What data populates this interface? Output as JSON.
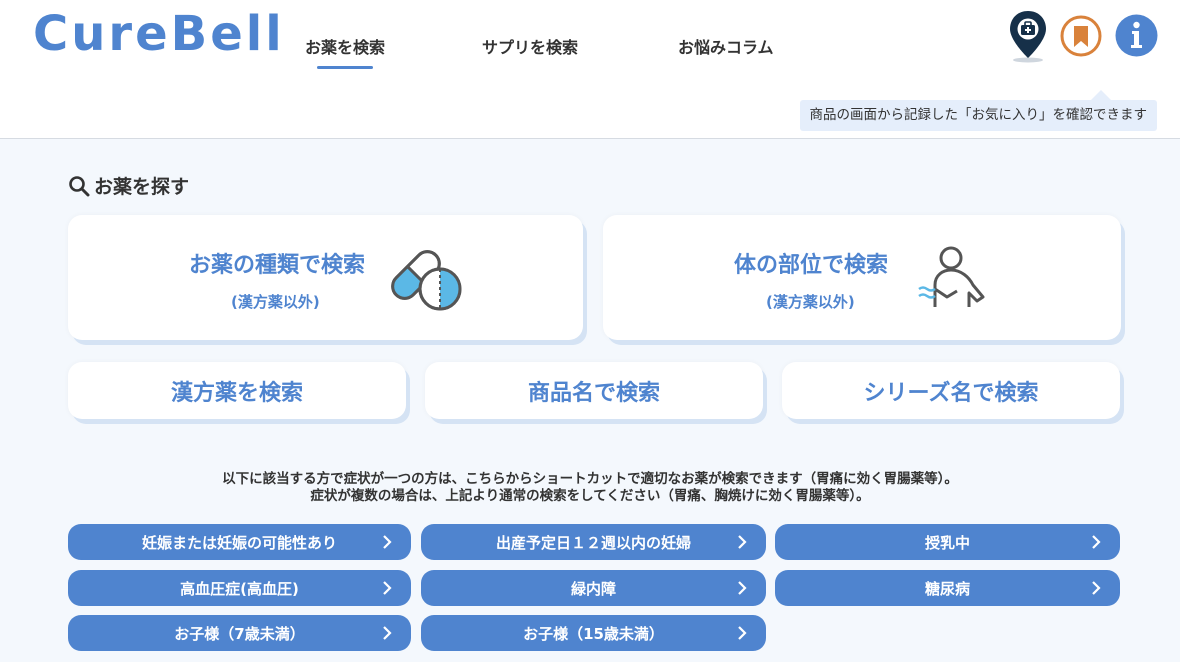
{
  "header": {
    "logo": "CureBell",
    "nav": [
      {
        "label": "お薬を検索",
        "active": true
      },
      {
        "label": "サプリを検索",
        "active": false
      },
      {
        "label": "お悩みコラム",
        "active": false
      }
    ],
    "icons": [
      "medical-map-pin-icon",
      "bookmark-icon",
      "info-icon"
    ],
    "hint": "商品の画面から記録した「お気に入り」を確認できます"
  },
  "search": {
    "title": "お薬を探す",
    "big_cards": [
      {
        "title": "お薬の種類で検索",
        "sub": "(漢方薬以外)",
        "icon": "pill-capsule-icon"
      },
      {
        "title": "体の部位で検索",
        "sub": "(漢方薬以外)",
        "icon": "body-stomach-icon"
      }
    ],
    "small_cards": [
      "漢方薬を検索",
      "商品名で検索",
      "シリーズ名で検索"
    ]
  },
  "notice": {
    "line1": "以下に該当する方で症状が一つの方は、こちらからショートカットで適切なお薬が検索できます（胃痛に効く胃腸薬等）。",
    "line2": "症状が複数の場合は、上記より通常の検索をしてください（胃痛、胸焼けに効く胃腸薬等）。"
  },
  "shortcuts": [
    "妊娠または妊娠の可能性あり",
    "出産予定日１２週以内の妊婦",
    "授乳中",
    "高血圧症(高血圧)",
    "緑内障",
    "糖尿病",
    "お子様（7歳未満）",
    "お子様（15歳未満）"
  ],
  "colors": {
    "brand": "#4f84cf",
    "bookmark": "#d9823b",
    "map_pin": "#163049",
    "page_bg": "#f4f8fd"
  }
}
